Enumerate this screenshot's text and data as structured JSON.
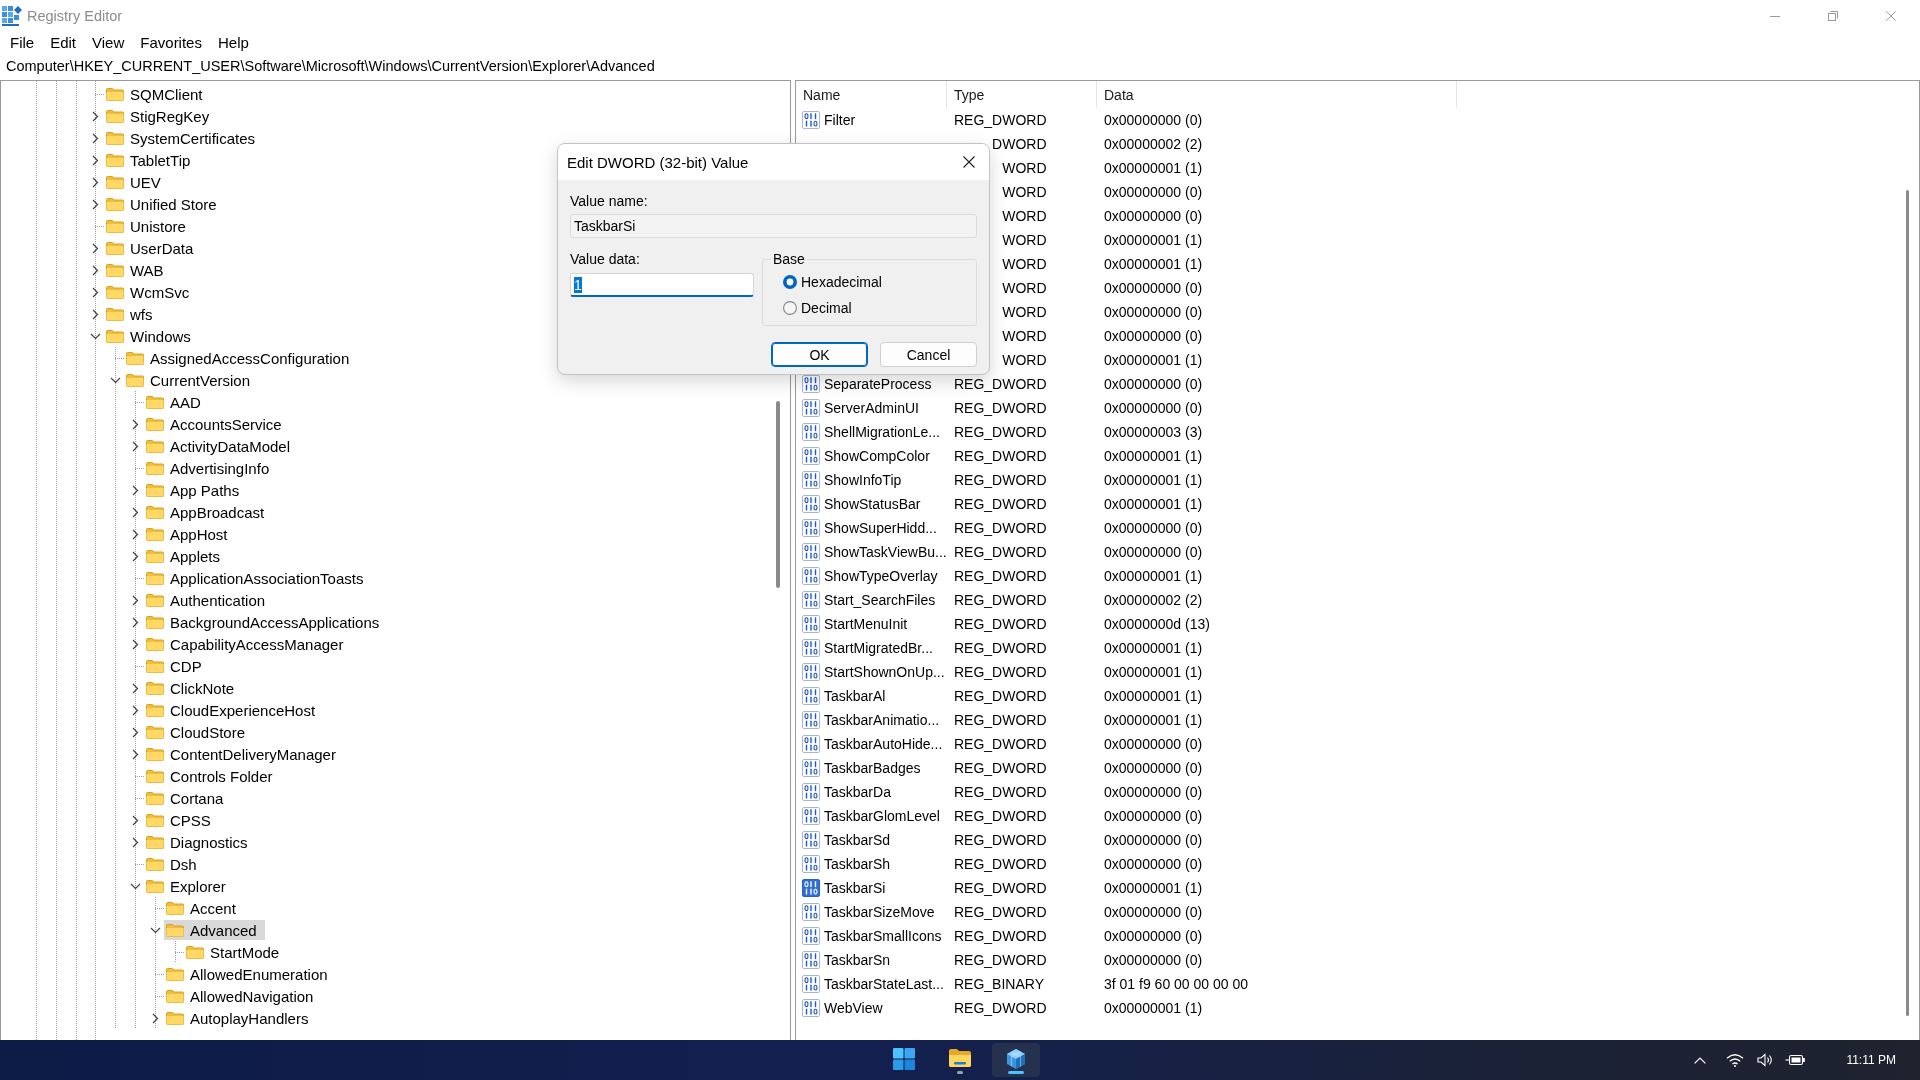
{
  "window": {
    "title": "Registry Editor"
  },
  "menu": [
    "File",
    "Edit",
    "View",
    "Favorites",
    "Help"
  ],
  "address_bar": {
    "value": "Computer\\HKEY_CURRENT_USER\\Software\\Microsoft\\Windows\\CurrentVersion\\Explorer\\Advanced"
  },
  "tree": {
    "items": [
      {
        "label": "SQMClient",
        "selected": false
      },
      {
        "label": "StigRegKey",
        "expanded": false,
        "selected": false
      },
      {
        "label": "SystemCertificates",
        "expanded": false,
        "selected": false
      },
      {
        "label": "TabletTip",
        "expanded": false,
        "selected": false
      },
      {
        "label": "UEV",
        "expanded": false,
        "selected": false
      },
      {
        "label": "Unified Store",
        "expanded": false,
        "selected": false
      },
      {
        "label": "Unistore",
        "selected": false
      },
      {
        "label": "UserData",
        "expanded": false,
        "selected": false
      },
      {
        "label": "WAB",
        "expanded": false,
        "selected": false
      },
      {
        "label": "WcmSvc",
        "expanded": false,
        "selected": false
      },
      {
        "label": "wfs",
        "expanded": false,
        "selected": false
      },
      {
        "label": "Windows",
        "expanded": true,
        "selected": false,
        "children": [
          {
            "label": "AssignedAccessConfiguration",
            "selected": false
          },
          {
            "label": "CurrentVersion",
            "expanded": true,
            "selected": false,
            "children": [
              {
                "label": "AAD",
                "selected": false
              },
              {
                "label": "AccountsService",
                "expanded": false,
                "selected": false
              },
              {
                "label": "ActivityDataModel",
                "expanded": false,
                "selected": false
              },
              {
                "label": "AdvertisingInfo",
                "selected": false
              },
              {
                "label": "App Paths",
                "expanded": false,
                "selected": false
              },
              {
                "label": "AppBroadcast",
                "expanded": false,
                "selected": false
              },
              {
                "label": "AppHost",
                "expanded": false,
                "selected": false
              },
              {
                "label": "Applets",
                "expanded": false,
                "selected": false
              },
              {
                "label": "ApplicationAssociationToasts",
                "selected": false
              },
              {
                "label": "Authentication",
                "expanded": false,
                "selected": false
              },
              {
                "label": "BackgroundAccessApplications",
                "expanded": false,
                "selected": false
              },
              {
                "label": "CapabilityAccessManager",
                "expanded": false,
                "selected": false
              },
              {
                "label": "CDP",
                "selected": false
              },
              {
                "label": "ClickNote",
                "expanded": false,
                "selected": false
              },
              {
                "label": "CloudExperienceHost",
                "expanded": false,
                "selected": false
              },
              {
                "label": "CloudStore",
                "expanded": false,
                "selected": false
              },
              {
                "label": "ContentDeliveryManager",
                "expanded": false,
                "selected": false
              },
              {
                "label": "Controls Folder",
                "selected": false
              },
              {
                "label": "Cortana",
                "selected": false
              },
              {
                "label": "CPSS",
                "expanded": false,
                "selected": false
              },
              {
                "label": "Diagnostics",
                "expanded": false,
                "selected": false
              },
              {
                "label": "Dsh",
                "selected": false
              },
              {
                "label": "Explorer",
                "expanded": true,
                "selected": false,
                "children": [
                  {
                    "label": "Accent",
                    "selected": false
                  },
                  {
                    "label": "Advanced",
                    "expanded": true,
                    "selected": true,
                    "children": [
                      {
                        "label": "StartMode",
                        "selected": false
                      }
                    ]
                  },
                  {
                    "label": "AllowedEnumeration",
                    "selected": false
                  },
                  {
                    "label": "AllowedNavigation",
                    "selected": false
                  },
                  {
                    "label": "AutoplayHandlers",
                    "expanded": false,
                    "selected": false
                  }
                ]
              }
            ]
          }
        ]
      }
    ]
  },
  "values_list": {
    "columns": [
      "Name",
      "Type",
      "Data"
    ],
    "rows": [
      {
        "kind": "full",
        "name": "Filter",
        "type": "REG_DWORD",
        "data": "0x00000000 (0)",
        "selected": false
      },
      {
        "kind": "covered",
        "type": "DWORD",
        "data": "0x00000002 (2)",
        "selected": false
      },
      {
        "kind": "covered",
        "type": "WORD",
        "data": "0x00000001 (1)",
        "selected": false
      },
      {
        "kind": "covered",
        "type": "WORD",
        "data": "0x00000000 (0)",
        "selected": false
      },
      {
        "kind": "covered",
        "type": "WORD",
        "data": "0x00000000 (0)",
        "selected": false
      },
      {
        "kind": "covered",
        "type": "WORD",
        "data": "0x00000001 (1)",
        "selected": false
      },
      {
        "kind": "covered",
        "type": "WORD",
        "data": "0x00000001 (1)",
        "selected": false
      },
      {
        "kind": "covered",
        "type": "WORD",
        "data": "0x00000000 (0)",
        "selected": false
      },
      {
        "kind": "covered",
        "type": "WORD",
        "data": "0x00000000 (0)",
        "selected": false
      },
      {
        "kind": "covered",
        "type": "WORD",
        "data": "0x00000000 (0)",
        "selected": false
      },
      {
        "kind": "covered",
        "type": "WORD",
        "data": "0x00000001 (1)",
        "selected": false
      },
      {
        "kind": "full",
        "name": "SeparateProcess",
        "type": "REG_DWORD",
        "data": "0x00000000 (0)",
        "selected": false
      },
      {
        "kind": "full",
        "name": "ServerAdminUI",
        "type": "REG_DWORD",
        "data": "0x00000000 (0)",
        "selected": false
      },
      {
        "kind": "full",
        "name": "ShellMigrationLe...",
        "type": "REG_DWORD",
        "data": "0x00000003 (3)",
        "selected": false
      },
      {
        "kind": "full",
        "name": "ShowCompColor",
        "type": "REG_DWORD",
        "data": "0x00000001 (1)",
        "selected": false
      },
      {
        "kind": "full",
        "name": "ShowInfoTip",
        "type": "REG_DWORD",
        "data": "0x00000001 (1)",
        "selected": false
      },
      {
        "kind": "full",
        "name": "ShowStatusBar",
        "type": "REG_DWORD",
        "data": "0x00000001 (1)",
        "selected": false
      },
      {
        "kind": "full",
        "name": "ShowSuperHidd...",
        "type": "REG_DWORD",
        "data": "0x00000000 (0)",
        "selected": false
      },
      {
        "kind": "full",
        "name": "ShowTaskViewBu...",
        "type": "REG_DWORD",
        "data": "0x00000000 (0)",
        "selected": false
      },
      {
        "kind": "full",
        "name": "ShowTypeOverlay",
        "type": "REG_DWORD",
        "data": "0x00000001 (1)",
        "selected": false
      },
      {
        "kind": "full",
        "name": "Start_SearchFiles",
        "type": "REG_DWORD",
        "data": "0x00000002 (2)",
        "selected": false
      },
      {
        "kind": "full",
        "name": "StartMenuInit",
        "type": "REG_DWORD",
        "data": "0x0000000d (13)",
        "selected": false
      },
      {
        "kind": "full",
        "name": "StartMigratedBr...",
        "type": "REG_DWORD",
        "data": "0x00000001 (1)",
        "selected": false
      },
      {
        "kind": "full",
        "name": "StartShownOnUp...",
        "type": "REG_DWORD",
        "data": "0x00000001 (1)",
        "selected": false
      },
      {
        "kind": "full",
        "name": "TaskbarAl",
        "type": "REG_DWORD",
        "data": "0x00000001 (1)",
        "selected": false
      },
      {
        "kind": "full",
        "name": "TaskbarAnimatio...",
        "type": "REG_DWORD",
        "data": "0x00000001 (1)",
        "selected": false
      },
      {
        "kind": "full",
        "name": "TaskbarAutoHide...",
        "type": "REG_DWORD",
        "data": "0x00000000 (0)",
        "selected": false
      },
      {
        "kind": "full",
        "name": "TaskbarBadges",
        "type": "REG_DWORD",
        "data": "0x00000000 (0)",
        "selected": false
      },
      {
        "kind": "full",
        "name": "TaskbarDa",
        "type": "REG_DWORD",
        "data": "0x00000000 (0)",
        "selected": false
      },
      {
        "kind": "full",
        "name": "TaskbarGlomLevel",
        "type": "REG_DWORD",
        "data": "0x00000000 (0)",
        "selected": false
      },
      {
        "kind": "full",
        "name": "TaskbarSd",
        "type": "REG_DWORD",
        "data": "0x00000000 (0)",
        "selected": false
      },
      {
        "kind": "full",
        "name": "TaskbarSh",
        "type": "REG_DWORD",
        "data": "0x00000000 (0)",
        "selected": false
      },
      {
        "kind": "full",
        "name": "TaskbarSi",
        "type": "REG_DWORD",
        "data": "0x00000001 (1)",
        "selected": true
      },
      {
        "kind": "full",
        "name": "TaskbarSizeMove",
        "type": "REG_DWORD",
        "data": "0x00000000 (0)",
        "selected": false
      },
      {
        "kind": "full",
        "name": "TaskbarSmallIcons",
        "type": "REG_DWORD",
        "data": "0x00000000 (0)",
        "selected": false
      },
      {
        "kind": "full",
        "name": "TaskbarSn",
        "type": "REG_DWORD",
        "data": "0x00000000 (0)",
        "selected": false
      },
      {
        "kind": "full",
        "name": "TaskbarStateLast...",
        "type": "REG_BINARY",
        "data": "3f 01 f9 60 00 00 00 00",
        "selected": false
      },
      {
        "kind": "full",
        "name": "WebView",
        "type": "REG_DWORD",
        "data": "0x00000001 (1)",
        "selected": false
      }
    ]
  },
  "dialog": {
    "title": "Edit DWORD (32-bit) Value",
    "value_name": {
      "label": "Value name:",
      "value": "TaskbarSi",
      "read_only": true
    },
    "value_data": {
      "label": "Value data:",
      "value": "1",
      "focused": true,
      "text_selected": true
    },
    "base": {
      "label": "Base",
      "options": [
        {
          "label": "Hexadecimal",
          "selected": true
        },
        {
          "label": "Decimal",
          "selected": false
        }
      ]
    },
    "buttons": [
      {
        "label": "OK",
        "default": true
      },
      {
        "label": "Cancel",
        "default": false
      }
    ]
  },
  "taskbar": {
    "apps": [
      {
        "kind": "start",
        "running": false,
        "active": false
      },
      {
        "kind": "files",
        "running": true,
        "active": false
      },
      {
        "kind": "registry",
        "running": true,
        "active": true
      }
    ],
    "tray": {
      "time": "11:11 PM"
    }
  }
}
